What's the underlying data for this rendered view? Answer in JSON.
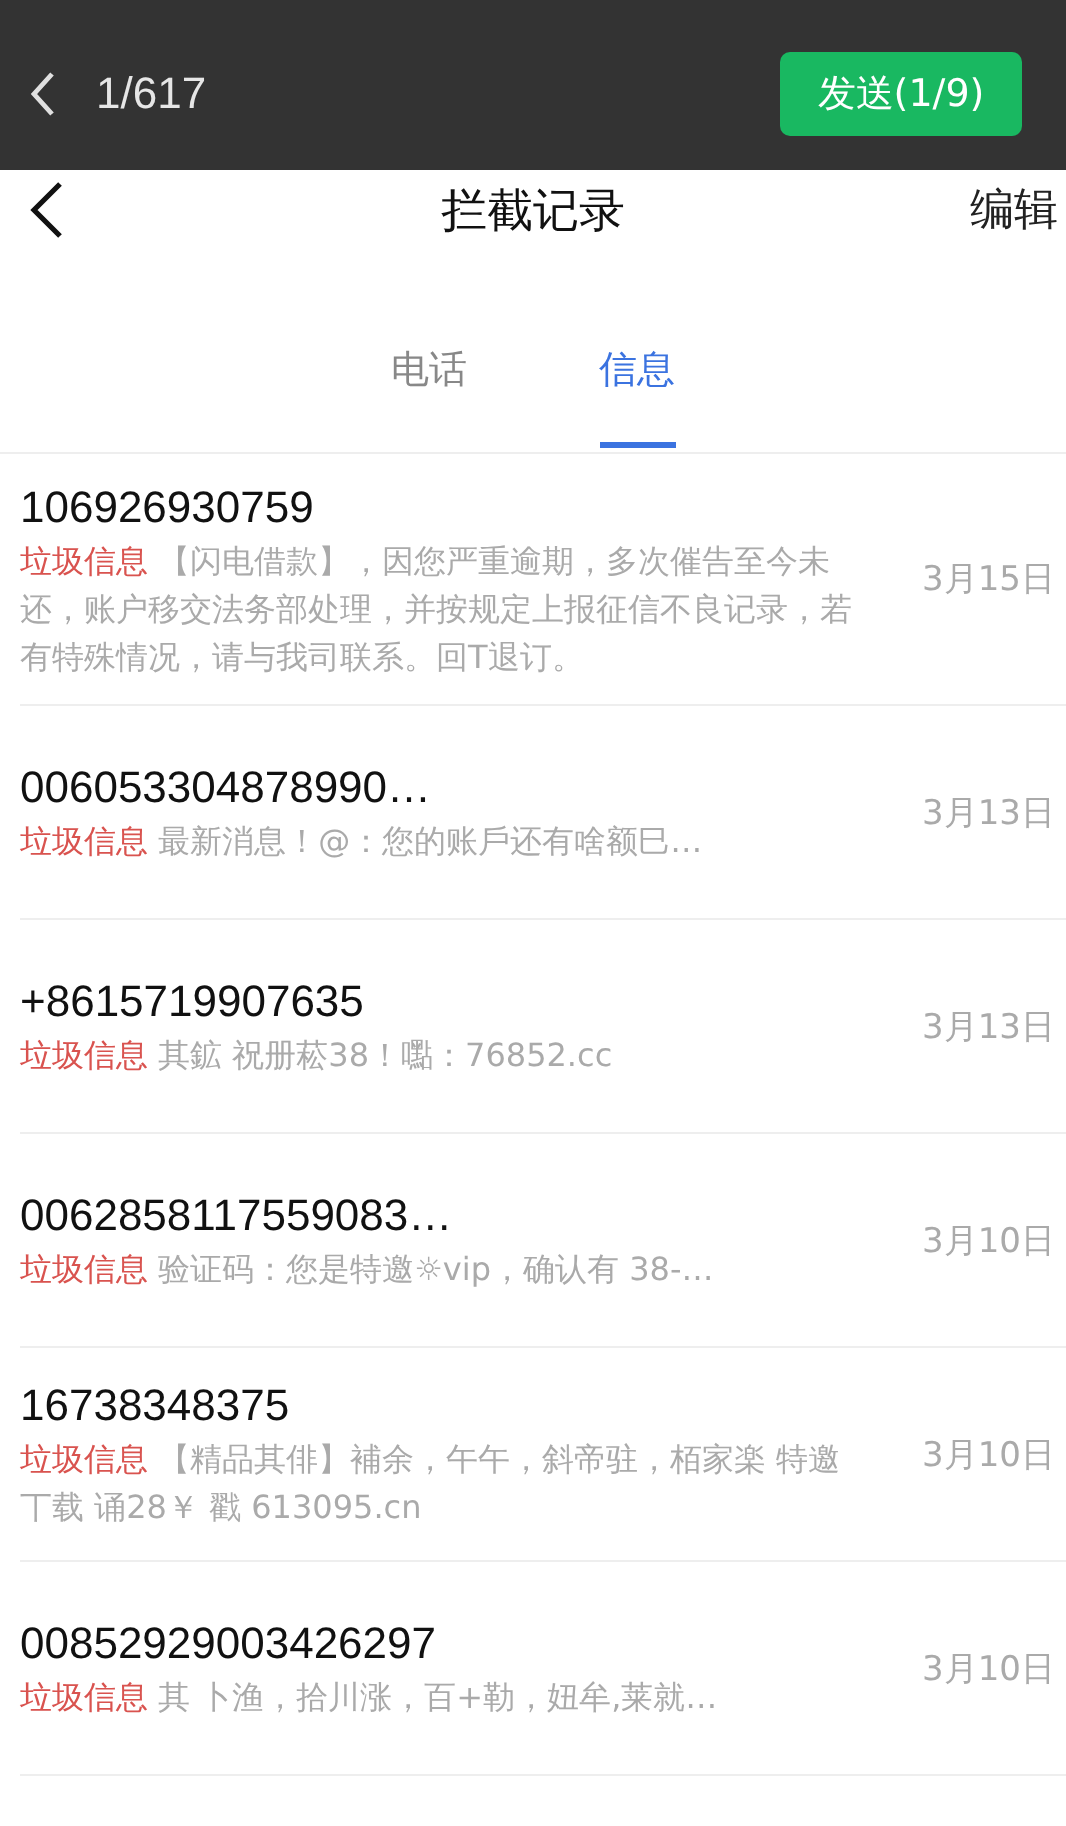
{
  "top_bar": {
    "counter": "1/617",
    "send_button": "发送(1/9)"
  },
  "nav": {
    "title": "拦截记录",
    "action": "编辑"
  },
  "tabs": [
    {
      "label": "电话",
      "selected": false
    },
    {
      "label": "信息",
      "selected": true
    }
  ],
  "messages": [
    {
      "sender": "106926930759",
      "tag": "垃圾信息",
      "preview": "【闪电借款】，因您严重逾期，多次催告至今未还，账户移交法务部处理，并按规定上报征信不良记录，若有特殊情况，请与我司联系。回T退订。",
      "date": "3月15日"
    },
    {
      "sender": "006053304878990…",
      "tag": "垃圾信息",
      "preview": "最新消息！@：您的账戶还有啥额巳…",
      "date": "3月13日"
    },
    {
      "sender": "+8615719907635",
      "tag": "垃圾信息",
      "preview": "其鉱 祝册菘38！嚸：76852.cc",
      "date": "3月13日"
    },
    {
      "sender": "0062858117559083…",
      "tag": "垃圾信息",
      "preview": "验证码：您是特邀☼vip，确认有 38-…",
      "date": "3月10日"
    },
    {
      "sender": "16738348375",
      "tag": "垃圾信息",
      "preview": "【精品其俳】補余，午午，斜帝驻，栢家楽 特邀丅载 诵28￥ 戳 613095.cn",
      "date": "3月10日"
    },
    {
      "sender": "00852929003426297",
      "tag": "垃圾信息",
      "preview": "其 卜渔，拾川涨，百+勒，妞牟,莱就…",
      "date": "3月10日"
    }
  ]
}
